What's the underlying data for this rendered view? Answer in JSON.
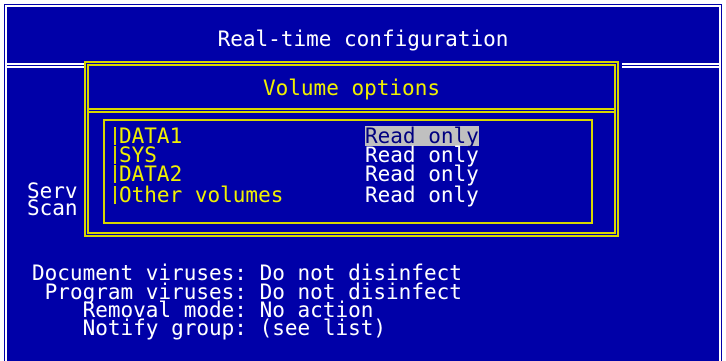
{
  "window": {
    "title": "Real-time configuration"
  },
  "background_labels": {
    "serv": "Serv",
    "scan": "Scan"
  },
  "dialog": {
    "title": "Volume options",
    "volumes": [
      {
        "name": "DATA1",
        "mode": "Read only",
        "selected": true
      },
      {
        "name": "SYS",
        "mode": "Read only",
        "selected": false
      },
      {
        "name": "DATA2",
        "mode": "Read only",
        "selected": false
      },
      {
        "name": "Other volumes",
        "mode": "Read only",
        "selected": false
      }
    ]
  },
  "settings": {
    "document_viruses": {
      "label": "Document viruses:",
      "value": "Do not disinfect"
    },
    "program_viruses": {
      "label": "Program viruses:",
      "value": "Do not disinfect"
    },
    "removal_mode": {
      "label": "Removal mode:",
      "value": "No action"
    },
    "notify_group": {
      "label": "Notify group:",
      "value": "(see list)"
    }
  },
  "colors": {
    "background_blue": "#0000a8",
    "frame_white": "#ffffff",
    "dialog_yellow": "#f0f000",
    "selection_gray": "#c0c0c0"
  }
}
